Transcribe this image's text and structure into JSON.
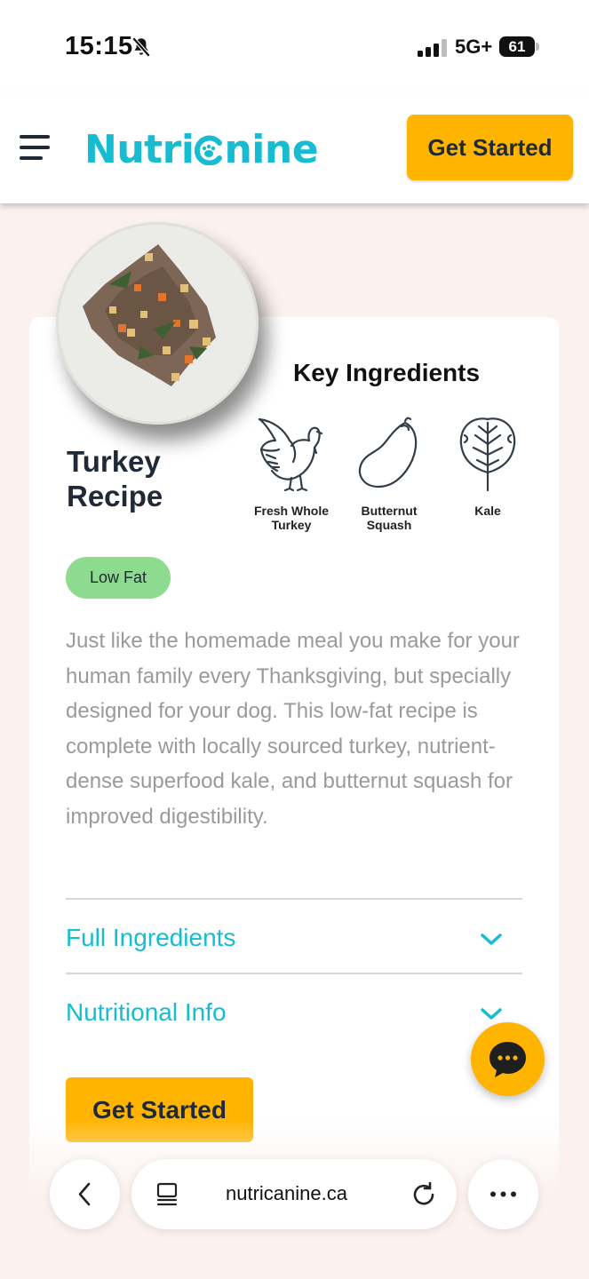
{
  "status_bar": {
    "time": "15:15",
    "network": "5G+",
    "battery": "61"
  },
  "header": {
    "logo_text_1": "Nutri",
    "logo_text_2": "nine",
    "cta_label": "Get Started"
  },
  "recipe": {
    "title_line1": "Turkey",
    "title_line2": "Recipe",
    "key_ingredients_title": "Key Ingredients",
    "ingredients": [
      {
        "label_line1": "Fresh Whole",
        "label_line2": "Turkey",
        "icon": "turkey-icon"
      },
      {
        "label_line1": "Butternut",
        "label_line2": "Squash",
        "icon": "squash-icon"
      },
      {
        "label_line1": "Kale",
        "label_line2": "",
        "icon": "kale-icon"
      }
    ],
    "badge": "Low Fat",
    "description": "Just like the homemade meal you make for your human family every Thanksgiving, but specially designed for your dog. This low-fat recipe is complete with locally sourced turkey, nutrient-dense superfood kale, and butternut squash for improved digestibility.",
    "accordions": [
      {
        "label": "Full Ingredients"
      },
      {
        "label": "Nutritional Info"
      }
    ],
    "cta_label": "Get Started"
  },
  "browser": {
    "url": "nutricanine.ca"
  },
  "colors": {
    "brand_teal": "#17bcd1",
    "cta_yellow": "#ffb400",
    "badge_green": "#8ddb8f",
    "page_bg": "#fbf1ee"
  }
}
